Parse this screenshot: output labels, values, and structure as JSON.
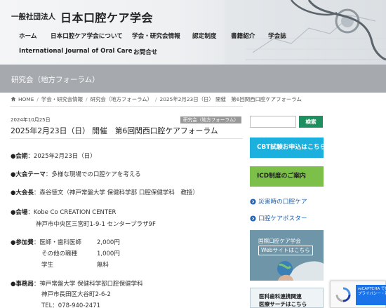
{
  "header": {
    "org_prefix": "一般社団法人",
    "site_name": "日本口腔ケア学会",
    "nav": [
      "ホーム",
      "日本口腔ケア学会について",
      "学会・研究会情報",
      "認定制度",
      "書籍紹介",
      "学会誌",
      "International Journal of Oral Care",
      "お問合せ"
    ]
  },
  "banner": {
    "title": "研究会（地方フォーラム）"
  },
  "breadcrumb": [
    "HOME",
    "学会・研究会情報",
    "研究会（地方フォーラム）",
    "2025年2月23日（日） 開催　第6回関西口腔ケアフォーラム"
  ],
  "post": {
    "date": "2024年10月25日",
    "category": "研究会（地方フォーラム）",
    "title": "2025年2月23日（日） 開催　第6回関西口腔ケアフォーラム",
    "session_label": "●会期",
    "session_value": "：2025年2月23日（日）",
    "theme_label": "●大会テーマ",
    "theme_value": "：多様な現場での口腔ケアを考える",
    "president_label": "●大会長",
    "president_value": "：森谷徳文（神戸常盤大学 保健科学部 口腔保健学科　教授）",
    "venue_label": "●会場",
    "venue_value": "：Kobe Co CREATION CENTER",
    "venue_address": "神戸市中央区三宮町1-9-1 センタープラザ9F",
    "fee_label": "●参加費",
    "fees": [
      {
        "name": "：医師・歯科医師",
        "amount": "2,000円"
      },
      {
        "name": "その他の職種",
        "amount": "1,000円"
      },
      {
        "name": "学生",
        "amount": "無料"
      }
    ],
    "office_label": "●事務局",
    "office_lines": [
      "：神戸常盤大学 保健科学部口腔保健学科",
      "神戸市長田区大谷町2-6-2",
      "TEL：078-940-2471"
    ]
  },
  "sidebar": {
    "search_placeholder": "",
    "search_button": "検索",
    "cbt_button": "CBT試験お申込はこちら",
    "icd_button": "ICD制度のご案内",
    "links": [
      "災害時の口腔ケア",
      "口腔ケアポスター"
    ],
    "ad1_lines": [
      "国際口腔ケア学会",
      "Webサイトはこちら"
    ],
    "ad2_lines": [
      "医科歯科連携関連",
      "医療サーチはこちら"
    ]
  },
  "recaptcha": {
    "label": "reCAPTCHA で保護",
    "terms": "プライバシー・利用規約"
  },
  "colors": {
    "accent_green": "#1e8f5e",
    "cbt_blue": "#1cb0de",
    "icd_green": "#7cc04a",
    "link_blue": "#2062b4",
    "banner_gray": "#a6a9ae"
  },
  "icons": [
    "home-icon",
    "circle-arrow-icon",
    "recaptcha-icon"
  ]
}
